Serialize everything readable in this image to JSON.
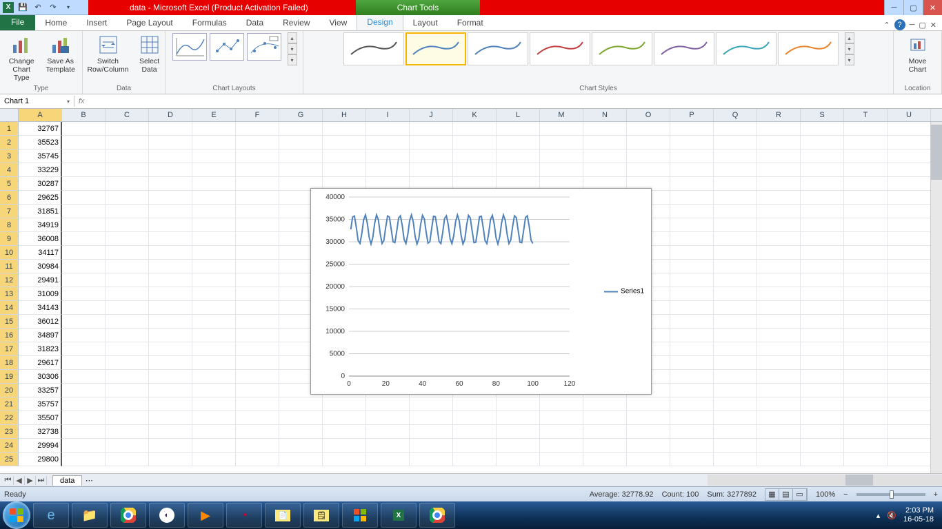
{
  "title": "data  -  Microsoft Excel (Product Activation Failed)",
  "chart_tools_label": "Chart Tools",
  "tabs": {
    "file": "File",
    "list": [
      "Home",
      "Insert",
      "Page Layout",
      "Formulas",
      "Data",
      "Review",
      "View",
      "Design",
      "Layout",
      "Format"
    ],
    "active": "Design"
  },
  "ribbon": {
    "type": {
      "label": "Type",
      "change": "Change\nChart Type",
      "save": "Save As\nTemplate"
    },
    "data": {
      "label": "Data",
      "switch": "Switch\nRow/Column",
      "select": "Select\nData"
    },
    "layouts": {
      "label": "Chart Layouts"
    },
    "styles": {
      "label": "Chart Styles"
    },
    "location": {
      "label": "Location",
      "move": "Move\nChart"
    },
    "style_colors": [
      "#555",
      "#4f81bd",
      "#4f81bd",
      "#c04040",
      "#7aa72c",
      "#7e5fa2",
      "#39a5b7",
      "#e8842c"
    ]
  },
  "namebox": "Chart 1",
  "columns": [
    "A",
    "B",
    "C",
    "D",
    "E",
    "F",
    "G",
    "H",
    "I",
    "J",
    "K",
    "L",
    "M",
    "N",
    "O",
    "P",
    "Q",
    "R",
    "S",
    "T",
    "U"
  ],
  "rows_visible": 25,
  "cells_colA": [
    32767,
    35523,
    35745,
    33229,
    30287,
    29625,
    31851,
    34919,
    36008,
    34117,
    30984,
    29491,
    31009,
    34143,
    36012,
    34897,
    31823,
    29617,
    30306,
    33257,
    35757,
    35507,
    32738,
    29994,
    29800
  ],
  "chart_data": {
    "type": "line",
    "title": "",
    "xlabel": "",
    "ylabel": "",
    "xlim": [
      0,
      120
    ],
    "ylim": [
      0,
      40000
    ],
    "xticks": [
      0,
      20,
      40,
      60,
      80,
      100,
      120
    ],
    "yticks": [
      0,
      5000,
      10000,
      15000,
      20000,
      25000,
      30000,
      35000,
      40000
    ],
    "series": [
      {
        "name": "Series1",
        "color": "#4f81bd"
      }
    ],
    "x": [
      1,
      2,
      3,
      4,
      5,
      6,
      7,
      8,
      9,
      10,
      11,
      12,
      13,
      14,
      15,
      16,
      17,
      18,
      19,
      20,
      21,
      22,
      23,
      24,
      25,
      26,
      27,
      28,
      29,
      30,
      31,
      32,
      33,
      34,
      35,
      36,
      37,
      38,
      39,
      40,
      41,
      42,
      43,
      44,
      45,
      46,
      47,
      48,
      49,
      50,
      51,
      52,
      53,
      54,
      55,
      56,
      57,
      58,
      59,
      60,
      61,
      62,
      63,
      64,
      65,
      66,
      67,
      68,
      69,
      70,
      71,
      72,
      73,
      74,
      75,
      76,
      77,
      78,
      79,
      80,
      81,
      82,
      83,
      84,
      85,
      86,
      87,
      88,
      89,
      90,
      91,
      92,
      93,
      94,
      95,
      96,
      97,
      98,
      99,
      100
    ],
    "y": [
      32767,
      35523,
      35745,
      33229,
      30287,
      29625,
      31851,
      34919,
      36008,
      34117,
      30984,
      29491,
      31009,
      34143,
      36012,
      34897,
      31823,
      29617,
      30306,
      33257,
      35757,
      35507,
      32738,
      29994,
      29800,
      32400,
      35300,
      35800,
      33600,
      30500,
      29600,
      31600,
      34700,
      36000,
      34400,
      31200,
      29500,
      30700,
      33900,
      35900,
      35100,
      32100,
      29700,
      30000,
      33000,
      35700,
      35600,
      33000,
      30100,
      29600,
      32100,
      35200,
      35800,
      33800,
      30700,
      29600,
      31400,
      34500,
      36000,
      34600,
      31400,
      29500,
      30500,
      33700,
      35900,
      35300,
      32400,
      29800,
      29900,
      32700,
      35600,
      35700,
      33200,
      30300,
      29600,
      31900,
      35000,
      35900,
      34000,
      30900,
      29500,
      31100,
      34200,
      36000,
      34800,
      31700,
      29600,
      30400,
      33400,
      35800,
      35400,
      32600,
      29900,
      29800,
      32500,
      35400,
      35800,
      33500,
      30400,
      29600
    ]
  },
  "legend_name": "Series1",
  "sheet_tab": "data",
  "status": {
    "ready": "Ready",
    "avg_label": "Average:",
    "avg": "32778.92",
    "count_label": "Count:",
    "count": "100",
    "sum_label": "Sum:",
    "sum": "3277892",
    "zoom": "100%"
  },
  "clock": {
    "time": "2:03 PM",
    "date": "16-05-18"
  }
}
